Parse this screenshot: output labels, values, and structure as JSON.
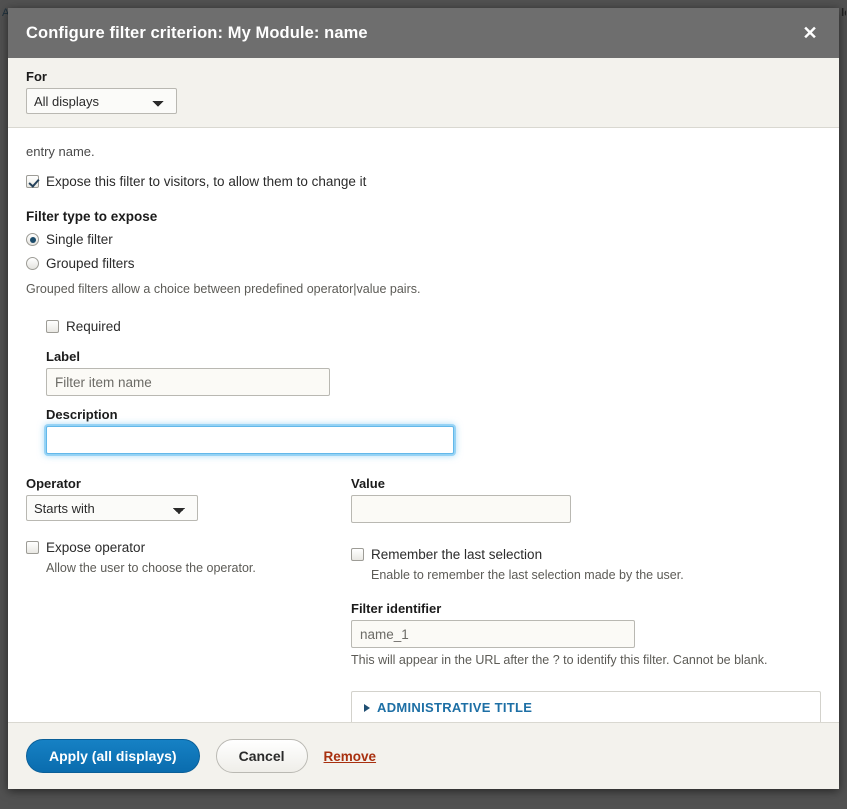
{
  "dialog": {
    "title": "Configure filter criterion: My Module: name",
    "close_icon": "close-icon"
  },
  "for_section": {
    "label": "For",
    "selected": "All displays",
    "options": [
      "All displays"
    ]
  },
  "body": {
    "entry_name_text": "entry name.",
    "expose_checkbox": {
      "label": "Expose this filter to visitors, to allow them to change it",
      "checked": true
    },
    "filter_type": {
      "heading": "Filter type to expose",
      "options": [
        {
          "label": "Single filter",
          "selected": true
        },
        {
          "label": "Grouped filters",
          "selected": false
        }
      ],
      "hint": "Grouped filters allow a choice between predefined operator|value pairs."
    },
    "required_checkbox": {
      "label": "Required",
      "checked": false
    },
    "label_field": {
      "label": "Label",
      "value": "Filter item name",
      "placeholder": "Filter item name"
    },
    "description_field": {
      "label": "Description",
      "value": "",
      "placeholder": "",
      "focused": true
    },
    "operator_field": {
      "label": "Operator",
      "selected": "Starts with",
      "options": [
        "Starts with"
      ]
    },
    "value_field": {
      "label": "Value",
      "value": "",
      "placeholder": ""
    },
    "expose_operator_checkbox": {
      "label": "Expose operator",
      "checked": false,
      "hint": "Allow the user to choose the operator."
    },
    "remember_selection_checkbox": {
      "label": "Remember the last selection",
      "checked": false,
      "hint": "Enable to remember the last selection made by the user."
    },
    "filter_identifier_field": {
      "label": "Filter identifier",
      "value": "name_1",
      "placeholder": "name_1",
      "hint": "This will appear in the URL after the ? to identify this filter. Cannot be blank."
    },
    "administrative_title": {
      "label": "ADMINISTRATIVE TITLE",
      "expanded": false,
      "toggle_icon": "chevron-right-icon"
    }
  },
  "footer": {
    "apply_label": "Apply (all displays)",
    "cancel_label": "Cancel",
    "remove_label": "Remove"
  },
  "colors": {
    "titlebar": "#6e6e6e",
    "primary_button": "#0a6cae",
    "danger_link": "#a8300f",
    "accent_link": "#1d6fa5",
    "focus_ring": "#63b8ea",
    "strip_background": "#f3f2ed"
  }
}
